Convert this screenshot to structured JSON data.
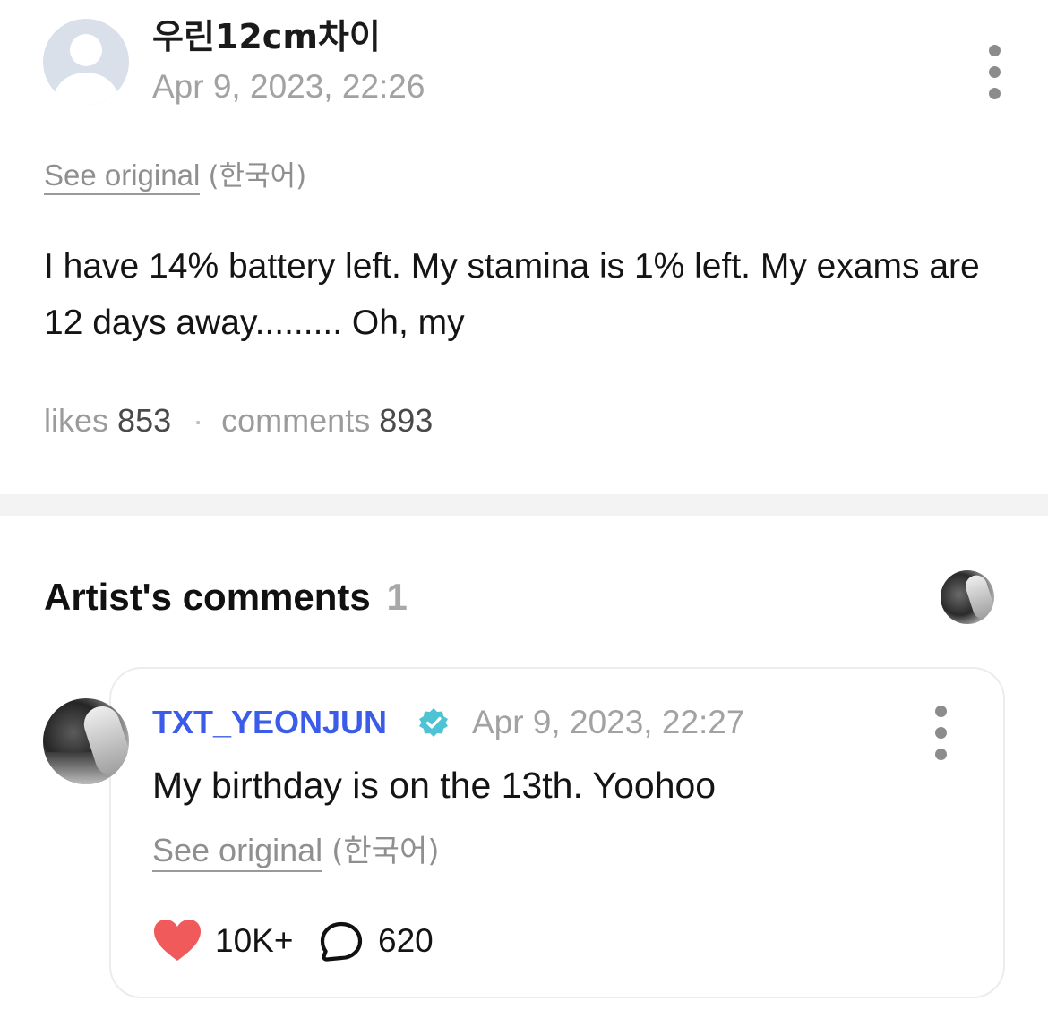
{
  "post": {
    "author": "우린12cm차이",
    "date": "Apr 9, 2023, 22:26",
    "see_original": "See original",
    "original_language": "(한국어)",
    "body": "I have 14% battery left. My stamina is 1% left. My exams are 12 days away......... Oh, my",
    "likes_label": "likes",
    "likes_count": "853",
    "separator": "·",
    "comments_label": "comments",
    "comments_count": "893",
    "more_icon": "vertical-ellipsis"
  },
  "artist_comments": {
    "title": "Artist's comments",
    "count": "1",
    "comments": [
      {
        "author": "TXT_YEONJUN",
        "verified": true,
        "verified_color": "#4ec3d4",
        "date": "Apr 9, 2023, 22:27",
        "text": "My birthday is on the 13th. Yoohoo",
        "see_original": "See original",
        "original_language": "(한국어)",
        "likes": "10K+",
        "replies": "620",
        "heart_color": "#f05a5a",
        "name_color": "#3b5ce8"
      }
    ]
  }
}
